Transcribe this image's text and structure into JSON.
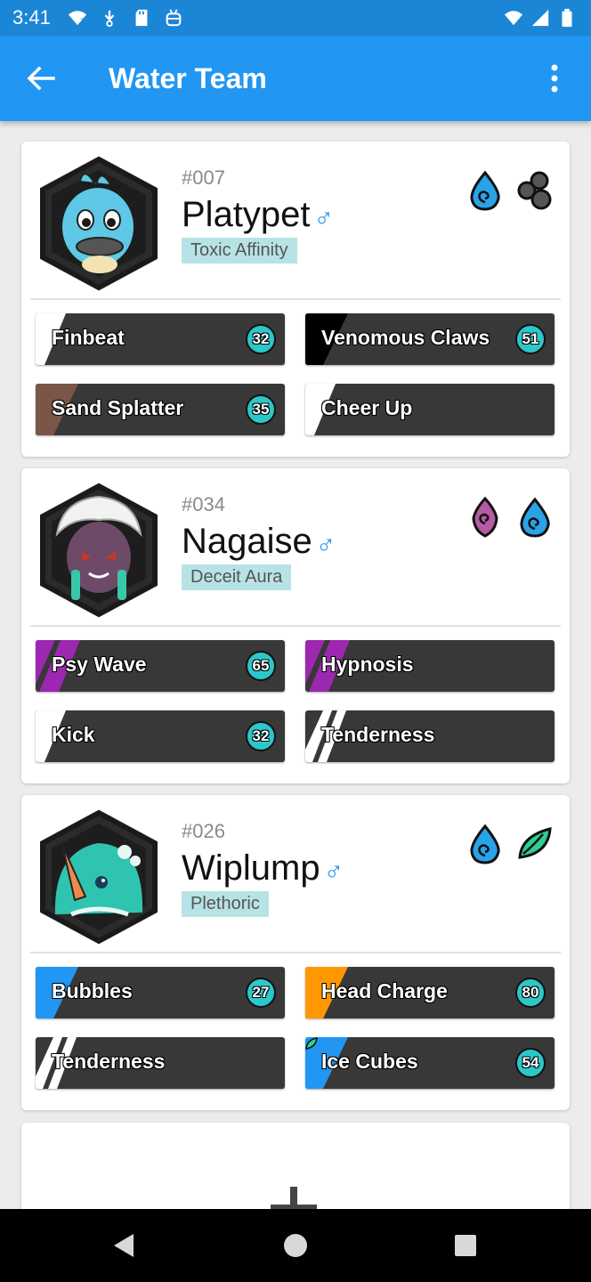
{
  "status_bar": {
    "time": "3:41",
    "icons": [
      "wifi-question-icon",
      "download-icon",
      "sd-card-icon",
      "android-icon",
      "wifi-signal-icon",
      "cell-signal-icon",
      "battery-icon"
    ]
  },
  "app_bar": {
    "title": "Water Team",
    "back_icon": "arrow-back-icon",
    "menu_icon": "more-vert-icon"
  },
  "team": [
    {
      "number": "#007",
      "name": "Platypet",
      "gender": "♂",
      "ability": "Toxic Affinity",
      "types": [
        "water-icon",
        "toxic-icon"
      ],
      "colors": {
        "body": "#5ec8e6"
      },
      "moves": [
        {
          "name": "Finbeat",
          "power": "32",
          "stripe_color": "#ffffff"
        },
        {
          "name": "Venomous Claws",
          "power": "51",
          "stripe_color": "#000000"
        },
        {
          "name": "Sand Splatter",
          "power": "35",
          "stripe_color": "#7a5548"
        },
        {
          "name": "Cheer Up",
          "power": "",
          "stripe_color": "#ffffff"
        }
      ]
    },
    {
      "number": "#034",
      "name": "Nagaise",
      "gender": "♂",
      "ability": "Deceit Aura",
      "types": [
        "mental-icon",
        "water-icon"
      ],
      "colors": {
        "body": "#6d4a67"
      },
      "moves": [
        {
          "name": "Psy Wave",
          "power": "65",
          "stripe_color": "#9c27b0"
        },
        {
          "name": "Hypnosis",
          "power": "",
          "stripe_color": "#9c27b0"
        },
        {
          "name": "Kick",
          "power": "32",
          "stripe_color": "#ffffff"
        },
        {
          "name": "Tenderness",
          "power": "",
          "stripe_color": "#ffffff"
        }
      ]
    },
    {
      "number": "#026",
      "name": "Wiplump",
      "gender": "♂",
      "ability": "Plethoric",
      "types": [
        "water-icon",
        "nature-icon"
      ],
      "colors": {
        "body": "#2fc4b0"
      },
      "moves": [
        {
          "name": "Bubbles",
          "power": "27",
          "stripe_color": "#2196f3"
        },
        {
          "name": "Head Charge",
          "power": "80",
          "stripe_color": "#ff9800"
        },
        {
          "name": "Tenderness",
          "power": "",
          "stripe_color": "#ffffff"
        },
        {
          "name": "Ice Cubes",
          "power": "54",
          "stripe_color": "#2196f3"
        }
      ]
    }
  ],
  "add_card": {
    "icon": "plus-icon"
  },
  "nav_bar": {
    "icons": [
      "back-triangle-icon",
      "home-circle-icon",
      "recents-square-icon"
    ]
  }
}
